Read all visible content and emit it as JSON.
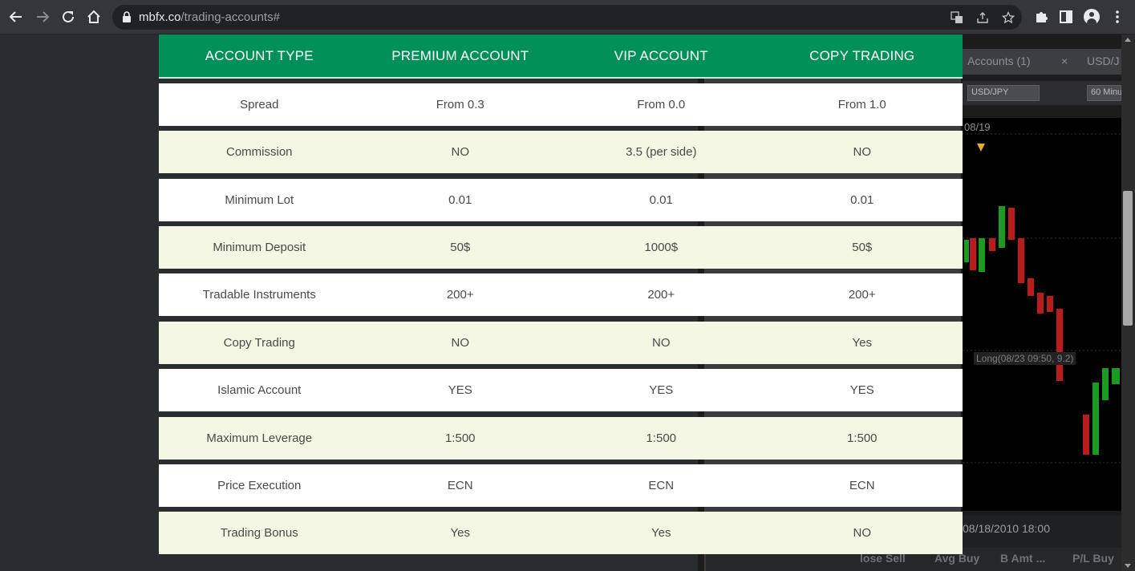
{
  "browser": {
    "url_host": "mbfx.co",
    "url_path": "/trading-accounts#"
  },
  "background": {
    "tab_accounts": "Accounts (1)",
    "tab_close": "×",
    "tab_pair": "USD/J",
    "select_pair": "USD/JPY",
    "select_period": "60 Minu",
    "date_top": "08/19",
    "long_label": "Long(08/23 09:50, 9.2)",
    "date_bottom": "08/18/2010 18:00",
    "footer": [
      "lose Sell",
      "Avg Buy",
      "B Amt ...",
      "P/L Buy"
    ]
  },
  "table": {
    "headers": [
      "ACCOUNT TYPE",
      "PREMIUM ACCOUNT",
      "VIP ACCOUNT",
      "COPY TRADING"
    ],
    "rows": [
      [
        "Spread",
        "From 0.3",
        "From 0.0",
        "From 1.0"
      ],
      [
        "Commission",
        "NO",
        "3.5 (per side)",
        "NO"
      ],
      [
        "Minimum Lot",
        "0.01",
        "0.01",
        "0.01"
      ],
      [
        "Minimum Deposit",
        "50$",
        "1000$",
        "50$"
      ],
      [
        "Tradable Instruments",
        "200+",
        "200+",
        "200+"
      ],
      [
        "Copy Trading",
        "NO",
        "NO",
        "Yes"
      ],
      [
        "Islamic Account",
        "YES",
        "YES",
        "YES"
      ],
      [
        "Maximum Leverage",
        "1:500",
        "1:500",
        "1:500"
      ],
      [
        "Price Execution",
        "ECN",
        "ECN",
        "ECN"
      ],
      [
        "Trading Bonus",
        "Yes",
        "Yes",
        "NO"
      ]
    ]
  }
}
